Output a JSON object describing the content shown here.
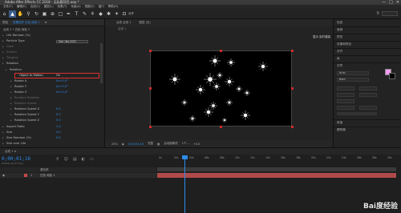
{
  "window": {
    "title": "Adobe After Effects CC 2018 - 无标题项目.aep *",
    "controls": [
      "—",
      "□",
      "✕"
    ]
  },
  "menu": [
    "文件(F)",
    "编辑(E)",
    "合成(C)",
    "图层(L)",
    "效果(T)",
    "动画(A)",
    "视图(V)",
    "窗口",
    "帮助(H)"
  ],
  "toolbar": {
    "snap_label": "对齐",
    "search_placeholder": "搜索帮助"
  },
  "effects_panel": {
    "tabs": [
      "项目",
      "效果控件 白色 纯色 1",
      "≡"
    ],
    "header": "合成 1 • 白色 纯色 1",
    "rows": [
      {
        "label": "Life Random (%)",
        "value": "",
        "indent": 8
      },
      {
        "label": "Particle Type",
        "value": "Star (No DOF)",
        "indent": 8,
        "box": true
      },
      {
        "label": "Glow",
        "value": "",
        "indent": 8,
        "dim": true
      },
      {
        "label": "Stretch",
        "value": "",
        "indent": 8,
        "dim": true
      },
      {
        "label": "Tangent",
        "value": "",
        "indent": 8,
        "dim": true
      },
      {
        "label": "Rotation",
        "value": "",
        "indent": 8
      },
      {
        "label": "Rotation",
        "value": "",
        "indent": 12
      },
      {
        "label": "Object to Motion",
        "value": "On",
        "indent": 16,
        "highlight": true
      },
      {
        "label": "Rotate X",
        "value": "0x+0.0°",
        "indent": 18
      },
      {
        "label": "Rotate Y",
        "value": "0x+0.0°",
        "indent": 18
      },
      {
        "label": "Rotate Z",
        "value": "0x+0.0°",
        "indent": 18
      },
      {
        "label": "Random Rotation",
        "value": "",
        "indent": 18,
        "dim": true
      },
      {
        "label": "Rotation Speed",
        "value": "",
        "indent": 18,
        "dim": true
      },
      {
        "label": "Rotation Speed X",
        "value": "0.0",
        "indent": 18
      },
      {
        "label": "Rotation Speed Y",
        "value": "0.0",
        "indent": 18
      },
      {
        "label": "Rotation Speed Z",
        "value": "0.0",
        "indent": 18
      },
      {
        "label": "Aspect Ratio",
        "value": "1.0",
        "indent": 8
      },
      {
        "label": "Size",
        "value": "4.0",
        "indent": 8
      },
      {
        "label": "Size Random (%)",
        "value": "0.0",
        "indent": 8
      },
      {
        "label": "Size over Life",
        "value": "",
        "indent": 8
      }
    ]
  },
  "composition": {
    "tabs": [
      "合成 合成 1",
      "图层 (无)"
    ],
    "sub": "合成 1",
    "corner_label": "显示 实时渲染",
    "footer": {
      "zoom": "25%",
      "time": "0;00;01;16",
      "resolution": "完整",
      "camera": "活动摄像机",
      "views": "1个...",
      "offset": "+0.0"
    }
  },
  "right_panel": {
    "sections": [
      "信息",
      "音频",
      "预览",
      "效果和预设",
      "对齐",
      "库",
      "字符",
      "段落",
      "跟踪器"
    ],
    "font_name": "Arial",
    "font_style": "Bold",
    "fill_color": "#f29bf0",
    "stroke_color": "#000000"
  },
  "timeline": {
    "tabs": [
      "合成 1 ≡"
    ],
    "time": "0;00;01;16",
    "frames": "00046 (29.97 fps)",
    "columns": "源名称",
    "layer_num": "1",
    "layer_name": "白色 纯色 1",
    "ruler": [
      "0s",
      "02s",
      "04s",
      "06s",
      "08s",
      "10s",
      "12s",
      "14s",
      "16s",
      "18s",
      "20s",
      "22s",
      "24s",
      "26s",
      "28s",
      "30s"
    ]
  },
  "watermark": {
    "main": "Bai度经验",
    "url": "jingyan.baidu.com"
  }
}
